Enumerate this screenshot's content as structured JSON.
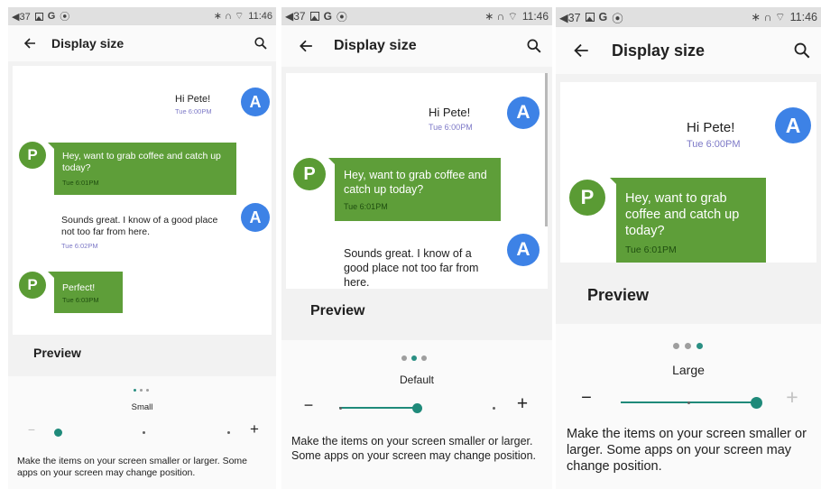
{
  "status": {
    "vol": "◀37",
    "g": "G",
    "at": "⦿",
    "icons": "∗ ∩ ⌔",
    "time": "11:46"
  },
  "toolbar": {
    "title": "Display size"
  },
  "messages": {
    "m1_text": "Hi Pete!",
    "m1_time": "Tue 6:00PM",
    "m2_text": "Hey, want to grab coffee and catch up today?",
    "m2_time": "Tue 6:01PM",
    "m3_text": "Sounds great. I know of a good place not too far from here.",
    "m3_time": "Tue 6:02PM",
    "m4_text": "Perfect!",
    "m4_time": "Tue 6:03PM",
    "avatar_a": "A",
    "avatar_p": "P"
  },
  "preview_label": "Preview",
  "panels": [
    {
      "size_label": "Small",
      "level": 0
    },
    {
      "size_label": "Default",
      "level": 1
    },
    {
      "size_label": "Large",
      "level": 2
    }
  ],
  "controls": {
    "minus": "−",
    "plus": "+"
  },
  "description": "Make the items on your screen smaller or larger. Some apps on your screen may change position.",
  "colors": {
    "accent": "#1f8a7a",
    "bubble": "#5e9e39",
    "avatar_a": "#3d82e6",
    "avatar_p": "#5a9b34"
  }
}
